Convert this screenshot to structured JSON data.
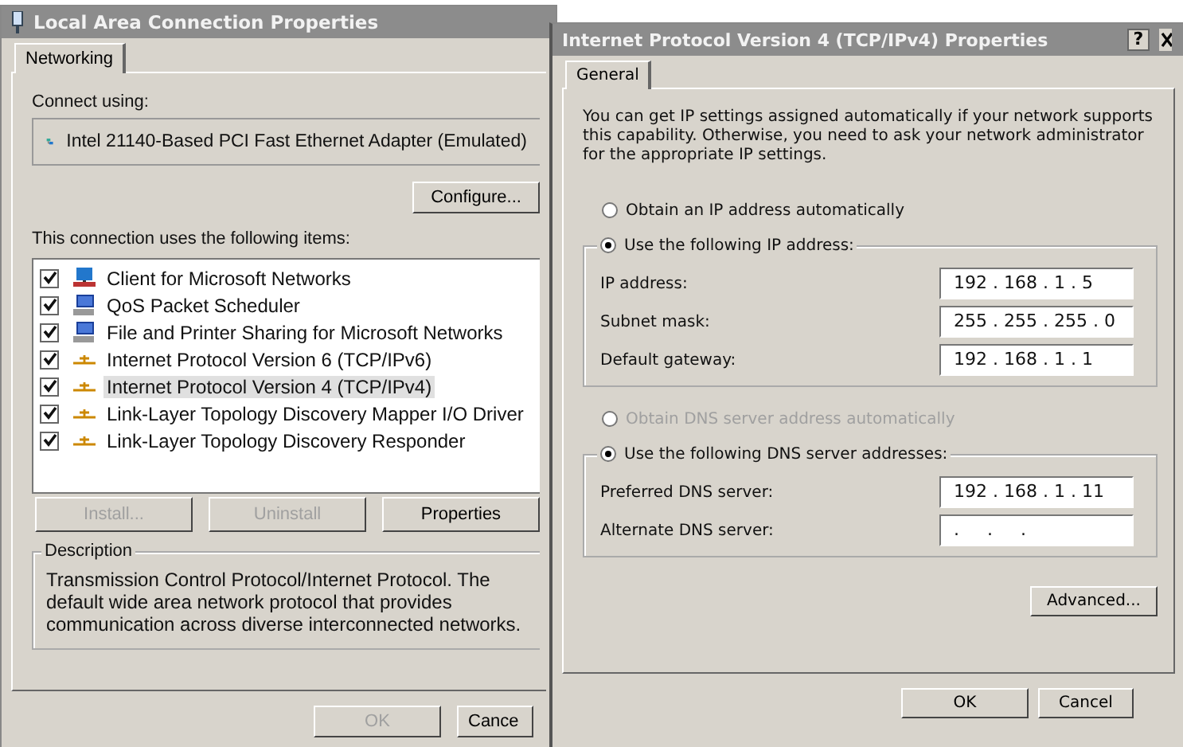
{
  "left_window": {
    "title": "Local Area Connection Properties",
    "tabs": [
      {
        "label": "Networking"
      }
    ],
    "connect_using_label": "Connect using:",
    "adapter": "Intel 21140-Based PCI Fast Ethernet Adapter (Emulated)",
    "configure_button": "Configure...",
    "items_label": "This connection uses the following items:",
    "items": [
      {
        "label": "Client for Microsoft Networks",
        "kind": "client",
        "checked": true,
        "selected": false
      },
      {
        "label": "QoS Packet Scheduler",
        "kind": "service",
        "checked": true,
        "selected": false
      },
      {
        "label": "File and Printer Sharing for Microsoft Networks",
        "kind": "service",
        "checked": true,
        "selected": false
      },
      {
        "label": "Internet Protocol Version 6 (TCP/IPv6)",
        "kind": "protocol",
        "checked": true,
        "selected": false
      },
      {
        "label": "Internet Protocol Version 4 (TCP/IPv4)",
        "kind": "protocol",
        "checked": true,
        "selected": true
      },
      {
        "label": "Link-Layer Topology Discovery Mapper I/O Driver",
        "kind": "protocol",
        "checked": true,
        "selected": false
      },
      {
        "label": "Link-Layer Topology Discovery Responder",
        "kind": "protocol",
        "checked": true,
        "selected": false
      }
    ],
    "item_buttons": [
      {
        "label": "Install...",
        "disabled": true
      },
      {
        "label": "Uninstall",
        "disabled": true
      },
      {
        "label": "Properties",
        "disabled": false
      }
    ],
    "description_title": "Description",
    "description": "Transmission Control Protocol/Internet Protocol. The default wide area network protocol that provides communication across diverse interconnected networks.",
    "buttons": [
      {
        "label": "OK",
        "disabled": true
      },
      {
        "label": "Cance",
        "disabled": false
      }
    ]
  },
  "right_window": {
    "title": "Internet Protocol Version 4 (TCP/IPv4) Properties",
    "help": "?",
    "tabs": [
      {
        "label": "General"
      }
    ],
    "intro": "You can get IP settings assigned automatically if your network supports this capability. Otherwise, you need to ask your network administrator for the appropriate IP settings.",
    "ip_options": [
      {
        "label": "Obtain an IP address automatically",
        "selected": false,
        "disabled": false
      },
      {
        "label": "Use the following IP address:",
        "selected": true,
        "disabled": false
      }
    ],
    "ip_fields": [
      {
        "label": "IP address:",
        "value": "192 . 168 . 1 . 5"
      },
      {
        "label": "Subnet mask:",
        "value": "255 . 255 . 255 . 0"
      },
      {
        "label": "Default gateway:",
        "value": "192 . 168 . 1 . 1"
      }
    ],
    "dns_options": [
      {
        "label": "Obtain DNS server address automatically",
        "selected": false,
        "disabled": true
      },
      {
        "label": "Use the following DNS server addresses:",
        "selected": true,
        "disabled": false
      }
    ],
    "dns_fields": [
      {
        "label": "Preferred DNS server:",
        "value": "192 . 168 . 1 . 11"
      },
      {
        "label": "Alternate DNS server:",
        "value": ".     .     ."
      }
    ],
    "advanced_button": "Advanced...",
    "buttons": [
      {
        "label": "OK",
        "disabled": false
      },
      {
        "label": "Cancel",
        "disabled": false
      }
    ]
  }
}
